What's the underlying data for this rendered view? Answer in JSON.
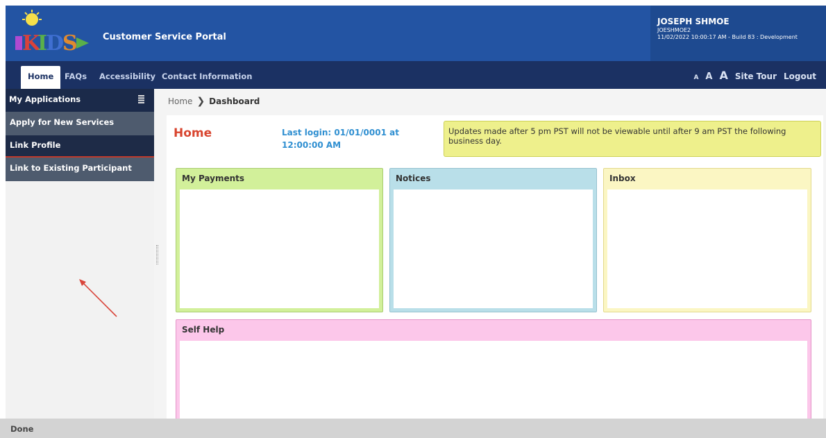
{
  "header": {
    "portal_title": "Customer Service Portal",
    "user_name": "JOSEPH SHMOE",
    "user_id": "JOESHMOE2",
    "session_info": "11/02/2022 10:00:17 AM - Build 83 : Development",
    "bg_color": "#2354a3"
  },
  "nav": {
    "tabs": [
      {
        "label": "Home"
      },
      {
        "label": "FAQs"
      },
      {
        "label": "Accessibility"
      },
      {
        "label": "Contact Information"
      }
    ],
    "font_small": "A",
    "font_medium": "A",
    "font_large": "A",
    "site_tour": "Site Tour",
    "logout": "Logout"
  },
  "sidebar": {
    "title": "My Applications",
    "items": [
      {
        "label": "Apply for New Services"
      },
      {
        "label": "Link Profile"
      },
      {
        "label": "Link to Existing Participant"
      }
    ]
  },
  "breadcrumb": {
    "home": "Home",
    "current": "Dashboard"
  },
  "main": {
    "title": "Home",
    "last_login": "Last login: 01/01/0001 at  12:00:00 AM",
    "update_note": "Updates made after 5 pm PST will not be viewable until after 9 am PST the following business day.",
    "panels": {
      "payments": "My Payments",
      "notices": "Notices",
      "inbox": "Inbox",
      "self_help": "Self Help"
    }
  },
  "status": {
    "text": "Done"
  }
}
